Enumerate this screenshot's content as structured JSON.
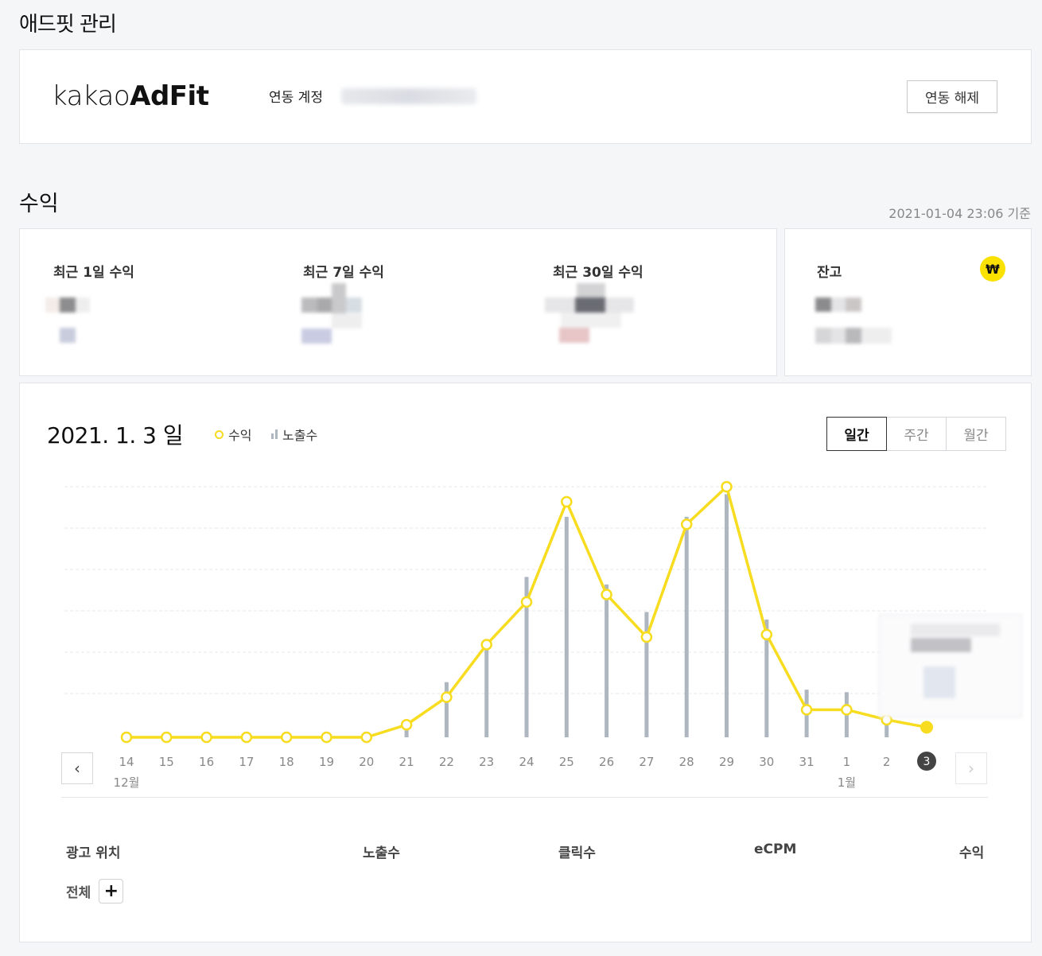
{
  "page": {
    "title": "애드핏 관리"
  },
  "account": {
    "logo_light": "kakao",
    "logo_bold": "AdFit",
    "label": "연동 계정",
    "unlink_button": "연동 해제"
  },
  "revenue": {
    "title": "수익",
    "timestamp": "2021-01-04 23:06 기준",
    "stats": [
      {
        "label": "최근 1일 수익"
      },
      {
        "label": "최근 7일 수익"
      },
      {
        "label": "최근 30일 수익"
      }
    ],
    "balance": {
      "label": "잔고",
      "icon": "won-icon"
    }
  },
  "chart_panel": {
    "date_title": "2021. 1. 3 일",
    "legend_revenue": "수익",
    "legend_impressions": "노출수",
    "tabs": [
      "일간",
      "주간",
      "월간"
    ],
    "active_tab": "일간"
  },
  "chart_data": {
    "type": "bar+line",
    "categories": [
      "14",
      "15",
      "16",
      "17",
      "18",
      "19",
      "20",
      "21",
      "22",
      "23",
      "24",
      "25",
      "26",
      "27",
      "28",
      "29",
      "30",
      "31",
      "1",
      "2",
      "3"
    ],
    "month_labels": [
      {
        "index": 0,
        "label": "12월"
      },
      {
        "index": 18,
        "label": "1월"
      }
    ],
    "selected_index": 20,
    "series": [
      {
        "name": "수익",
        "kind": "line",
        "color": "#f7dc20",
        "values": [
          0,
          0,
          0,
          0,
          0,
          0,
          0,
          5,
          16,
          37,
          54,
          94,
          57,
          40,
          85,
          100,
          41,
          11,
          11,
          7,
          4
        ]
      },
      {
        "name": "노출수",
        "kind": "bar",
        "color": "#aeb6c0",
        "values": [
          0,
          0,
          0,
          0,
          0,
          0,
          0,
          3,
          22,
          38,
          64,
          88,
          61,
          50,
          88,
          97,
          47,
          19,
          18,
          19,
          0
        ]
      }
    ],
    "ylim": [
      0,
      120
    ],
    "grid": true,
    "gridlines": 6
  },
  "table": {
    "headers": [
      "광고 위치",
      "노출수",
      "클릭수",
      "eCPM",
      "수익"
    ],
    "row_label": "전체",
    "expand_label": "+"
  },
  "icons": {
    "prev": "‹",
    "next": "›",
    "won": "₩"
  }
}
